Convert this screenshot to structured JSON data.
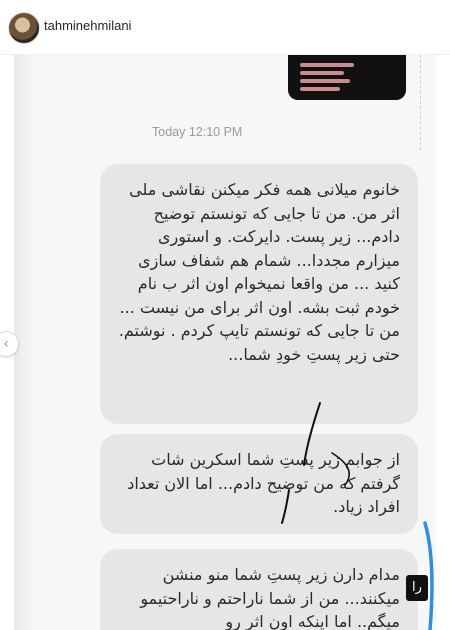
{
  "header": {
    "username": "tahminehmilani"
  },
  "story": {
    "thumbnail_note": "story preview"
  },
  "chat": {
    "timestamp": "Today 12:10 PM",
    "messages": [
      "خانوم میلانی همه فکر میکنن نقاشی ملی اثر من. من تا جایی که تونستم توضیح دادم... زیر پست. دایرکت. و استوری میزارم مجددا... شمام هم شفاف سازی کنید ... من واقعا نمیخوام اون اثر ب نام خودم ثبت بشه. اون اثر برای من نیست ... من تا جایی که تونستم تایپ کردم . نوشتم. حتی زیر پستِ خودِ شما...",
      "از جوابم زیر پستِ شما اسکرین شات گرفتم که من توضیح دادم... اما الان تعداد افراد زیاد.",
      "مدام دارن زیر پستِ شما منو منشن میکنند... من از شما ناراحتم و ناراحتیمو میگم.. اما اینکه اون اثر رو"
    ],
    "side_label": "را"
  },
  "nav": {
    "prev_glyph": "‹"
  },
  "colors": {
    "bubble": "#e6e6e6",
    "scribble": "#111111",
    "accent_blue": "#2f8ee0"
  }
}
